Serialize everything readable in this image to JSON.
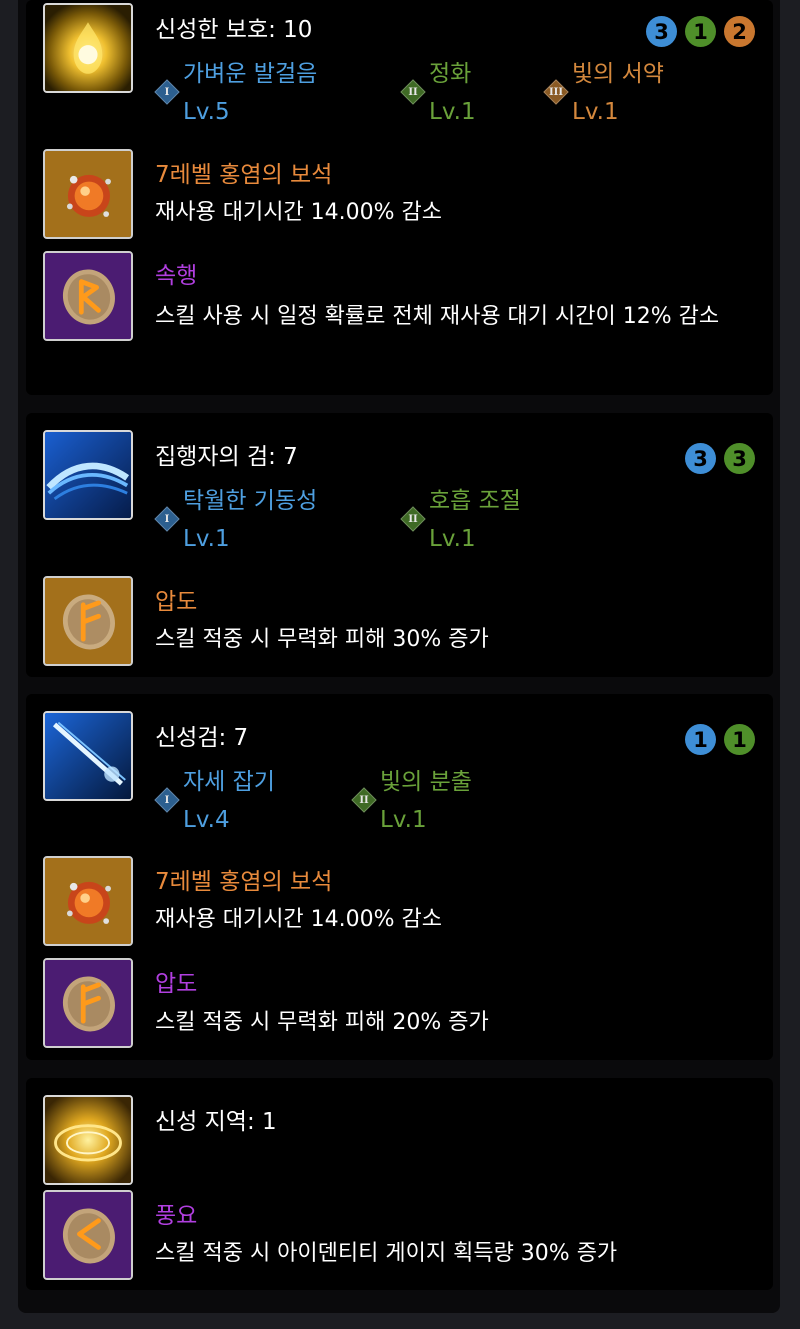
{
  "skills": [
    {
      "title": "신성한 보호: 10",
      "pips": [
        {
          "value": "3",
          "color": "#3e8ed6"
        },
        {
          "value": "1",
          "color": "#4f8f2a"
        },
        {
          "value": "2",
          "color": "#c9772f"
        }
      ],
      "tripods": [
        {
          "numeral": "I",
          "name": "가벼운 발걸음",
          "level": "Lv.5"
        },
        {
          "numeral": "II",
          "name": "정화",
          "level": "Lv.1"
        },
        {
          "numeral": "III",
          "name": "빛의 서약",
          "level": "Lv.1"
        }
      ],
      "gem": {
        "name": "7레벨 홍염의 보석",
        "desc": "재사용 대기시간 14.00% 감소"
      },
      "rune": {
        "name": "속행",
        "desc": "스킬 사용 시 일정 확률로 전체 재사용 대기 시간이 12% 감소"
      }
    },
    {
      "title": "집행자의 검: 7",
      "pips": [
        {
          "value": "3",
          "color": "#3e8ed6"
        },
        {
          "value": "3",
          "color": "#4f8f2a"
        }
      ],
      "tripods": [
        {
          "numeral": "I",
          "name": "탁월한 기동성",
          "level": "Lv.1"
        },
        {
          "numeral": "II",
          "name": "호흡 조절",
          "level": "Lv.1"
        }
      ],
      "rune": {
        "name": "압도",
        "desc": "스킬 적중 시 무력화 피해 30% 증가"
      }
    },
    {
      "title": "신성검: 7",
      "pips": [
        {
          "value": "1",
          "color": "#3e8ed6"
        },
        {
          "value": "1",
          "color": "#4f8f2a"
        }
      ],
      "tripods": [
        {
          "numeral": "I",
          "name": "자세 잡기",
          "level": "Lv.4"
        },
        {
          "numeral": "II",
          "name": "빛의 분출",
          "level": "Lv.1"
        }
      ],
      "gem": {
        "name": "7레벨 홍염의 보석",
        "desc": "재사용 대기시간 14.00% 감소"
      },
      "rune": {
        "name": "압도",
        "desc": "스킬 적중 시 무력화 피해 20% 증가"
      }
    },
    {
      "title": "신성 지역: 1",
      "rune": {
        "name": "풍요",
        "desc": "스킬 적중 시 아이덴티티 게이지 획득량 30% 증가"
      }
    }
  ]
}
